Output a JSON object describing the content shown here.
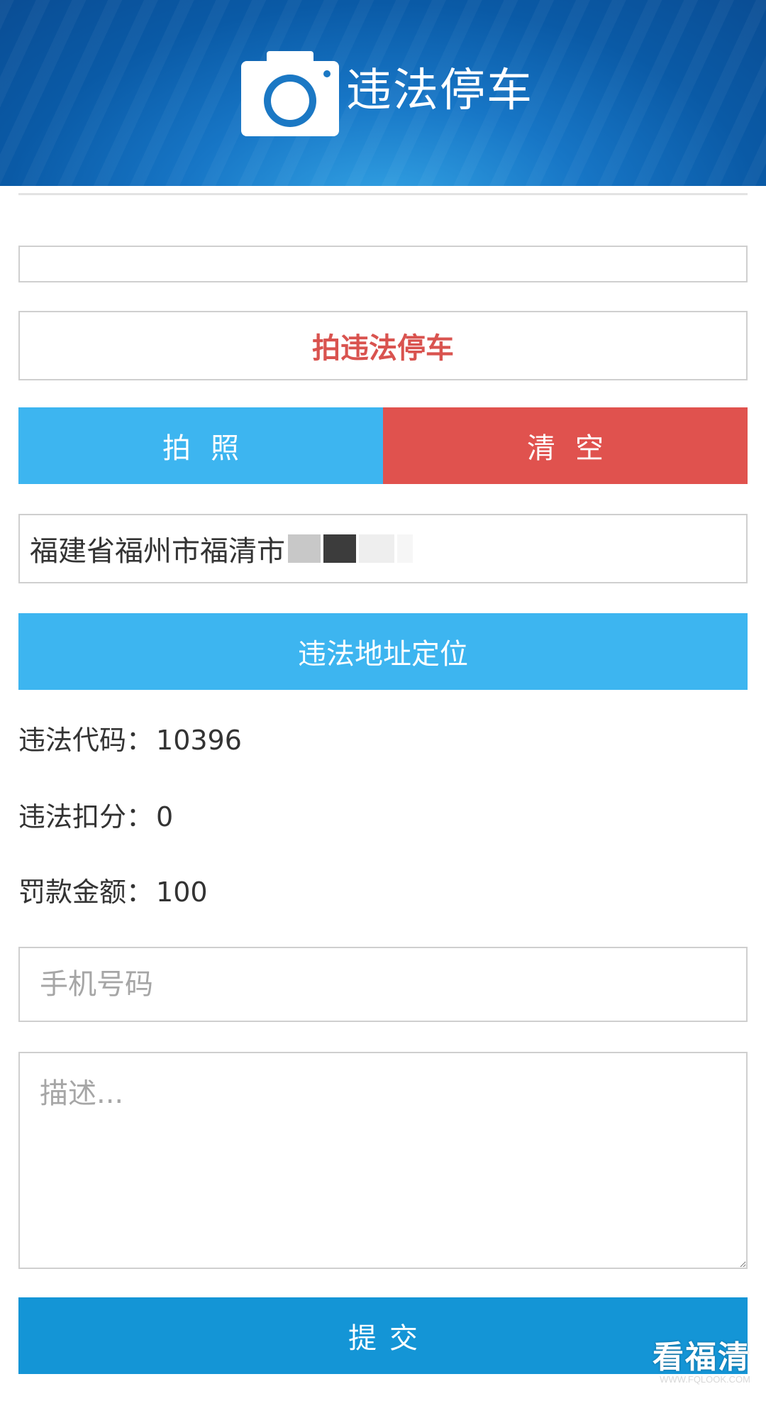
{
  "header": {
    "title": "违法停车",
    "icon": "camera-icon"
  },
  "form": {
    "capture_title": "拍违法停车",
    "photo_button": "拍照",
    "clear_button": "清空",
    "address_value": "福建省福州市福清市",
    "locate_button": "违法地址定位",
    "violation_code_label": "违法代码：",
    "violation_code_value": "10396",
    "points_label": "违法扣分：",
    "points_value": "0",
    "fine_label": "罚款金额：",
    "fine_value": "100",
    "phone_placeholder": "手机号码",
    "description_placeholder": "描述...",
    "submit_button": "提交"
  },
  "colors": {
    "header_blue": "#0a5aa6",
    "accent_blue": "#3db5f0",
    "danger_red": "#e0524e",
    "submit_blue": "#1495d6",
    "title_red": "#d9534f"
  },
  "watermark": {
    "main": "看福清",
    "sub": "WWW.FQLOOK.COM"
  }
}
